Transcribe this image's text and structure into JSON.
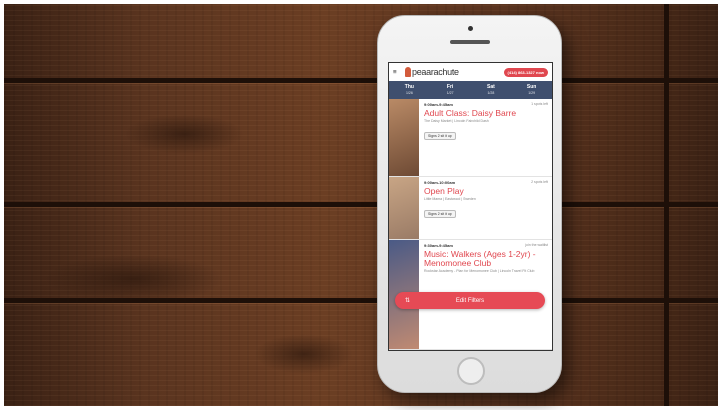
{
  "app": {
    "logo_text": "peaarachute",
    "phone_label": "(414) 863-1327 now"
  },
  "day_tabs": [
    {
      "day": "Thu",
      "date": "1/26"
    },
    {
      "day": "Fri",
      "date": "1/27"
    },
    {
      "day": "Sat",
      "date": "1/28"
    },
    {
      "day": "Sun",
      "date": "1/29"
    }
  ],
  "classes": [
    {
      "time": "9:00am-9:45am",
      "spots": "1 spots left",
      "title": "Adult Class: Daisy Barre",
      "location": "The Daisy Market | Lincoln Fairchild Dash",
      "signup": "Signs 2 sit it up",
      "thumb_colors": [
        "#b98a66",
        "#6e4a34"
      ]
    },
    {
      "time": "9:00am-10:00am",
      "spots": "2 spots left",
      "title": "Open Play",
      "location": "Little Mama | Eastwood | Sweden",
      "signup": "Signs 2 sit it up",
      "thumb_colors": [
        "#c8a585",
        "#9a7b66"
      ]
    },
    {
      "time": "9:30am-9:45am",
      "spots": "join the waitlist",
      "title": "Music: Walkers (Ages 1-2yr) - Menomonee Club",
      "location": "Rockstar Academy - Plan for Menomonee Club | Lincoln Travel Fit Club",
      "signup": "",
      "thumb_colors": [
        "#4a5a86",
        "#c08a72"
      ]
    }
  ],
  "filter_button": {
    "label": "Edit Filters"
  }
}
